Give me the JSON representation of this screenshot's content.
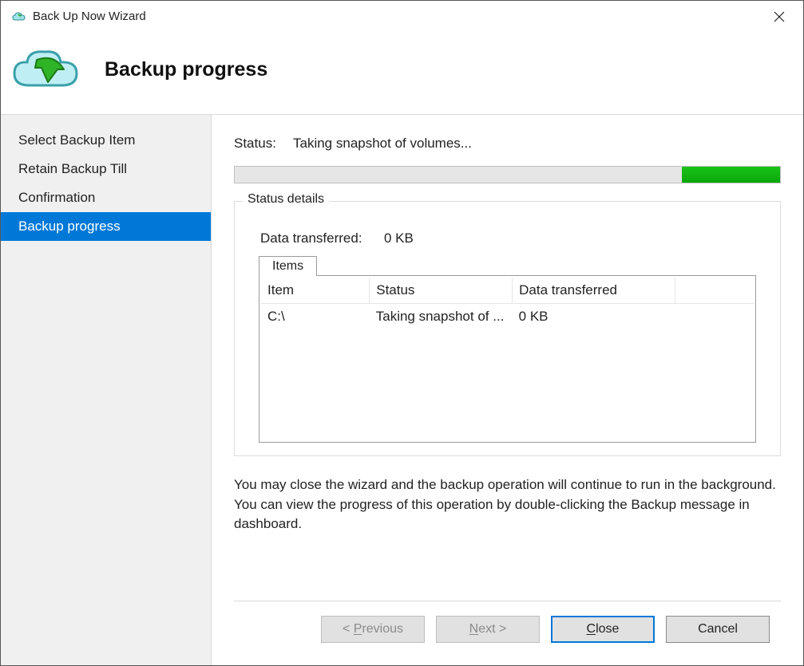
{
  "window": {
    "title": "Back Up Now Wizard"
  },
  "header": {
    "page_title": "Backup progress"
  },
  "sidebar": {
    "items": [
      {
        "label": "Select Backup Item",
        "selected": false
      },
      {
        "label": "Retain Backup Till",
        "selected": false
      },
      {
        "label": "Confirmation",
        "selected": false
      },
      {
        "label": "Backup progress",
        "selected": true
      }
    ]
  },
  "status": {
    "label": "Status:",
    "value": "Taking snapshot of volumes..."
  },
  "progress": {
    "chunk_start_pct": 82,
    "chunk_width_pct": 18
  },
  "details": {
    "group_title": "Status details",
    "data_transferred_label": "Data transferred:",
    "data_transferred_value": "0 KB",
    "tab_label": "Items",
    "columns": {
      "c0": "Item",
      "c1": "Status",
      "c2": "Data transferred"
    },
    "rows": [
      {
        "item": "C:\\",
        "status": "Taking snapshot of ...",
        "transferred": "0 KB"
      }
    ]
  },
  "info_text": "You may close the wizard and the backup operation will continue to run in the background. You can view the progress of this operation by double-clicking the Backup message in dashboard.",
  "buttons": {
    "previous": "< Previous",
    "next": "Next >",
    "close": "Close",
    "cancel": "Cancel"
  }
}
